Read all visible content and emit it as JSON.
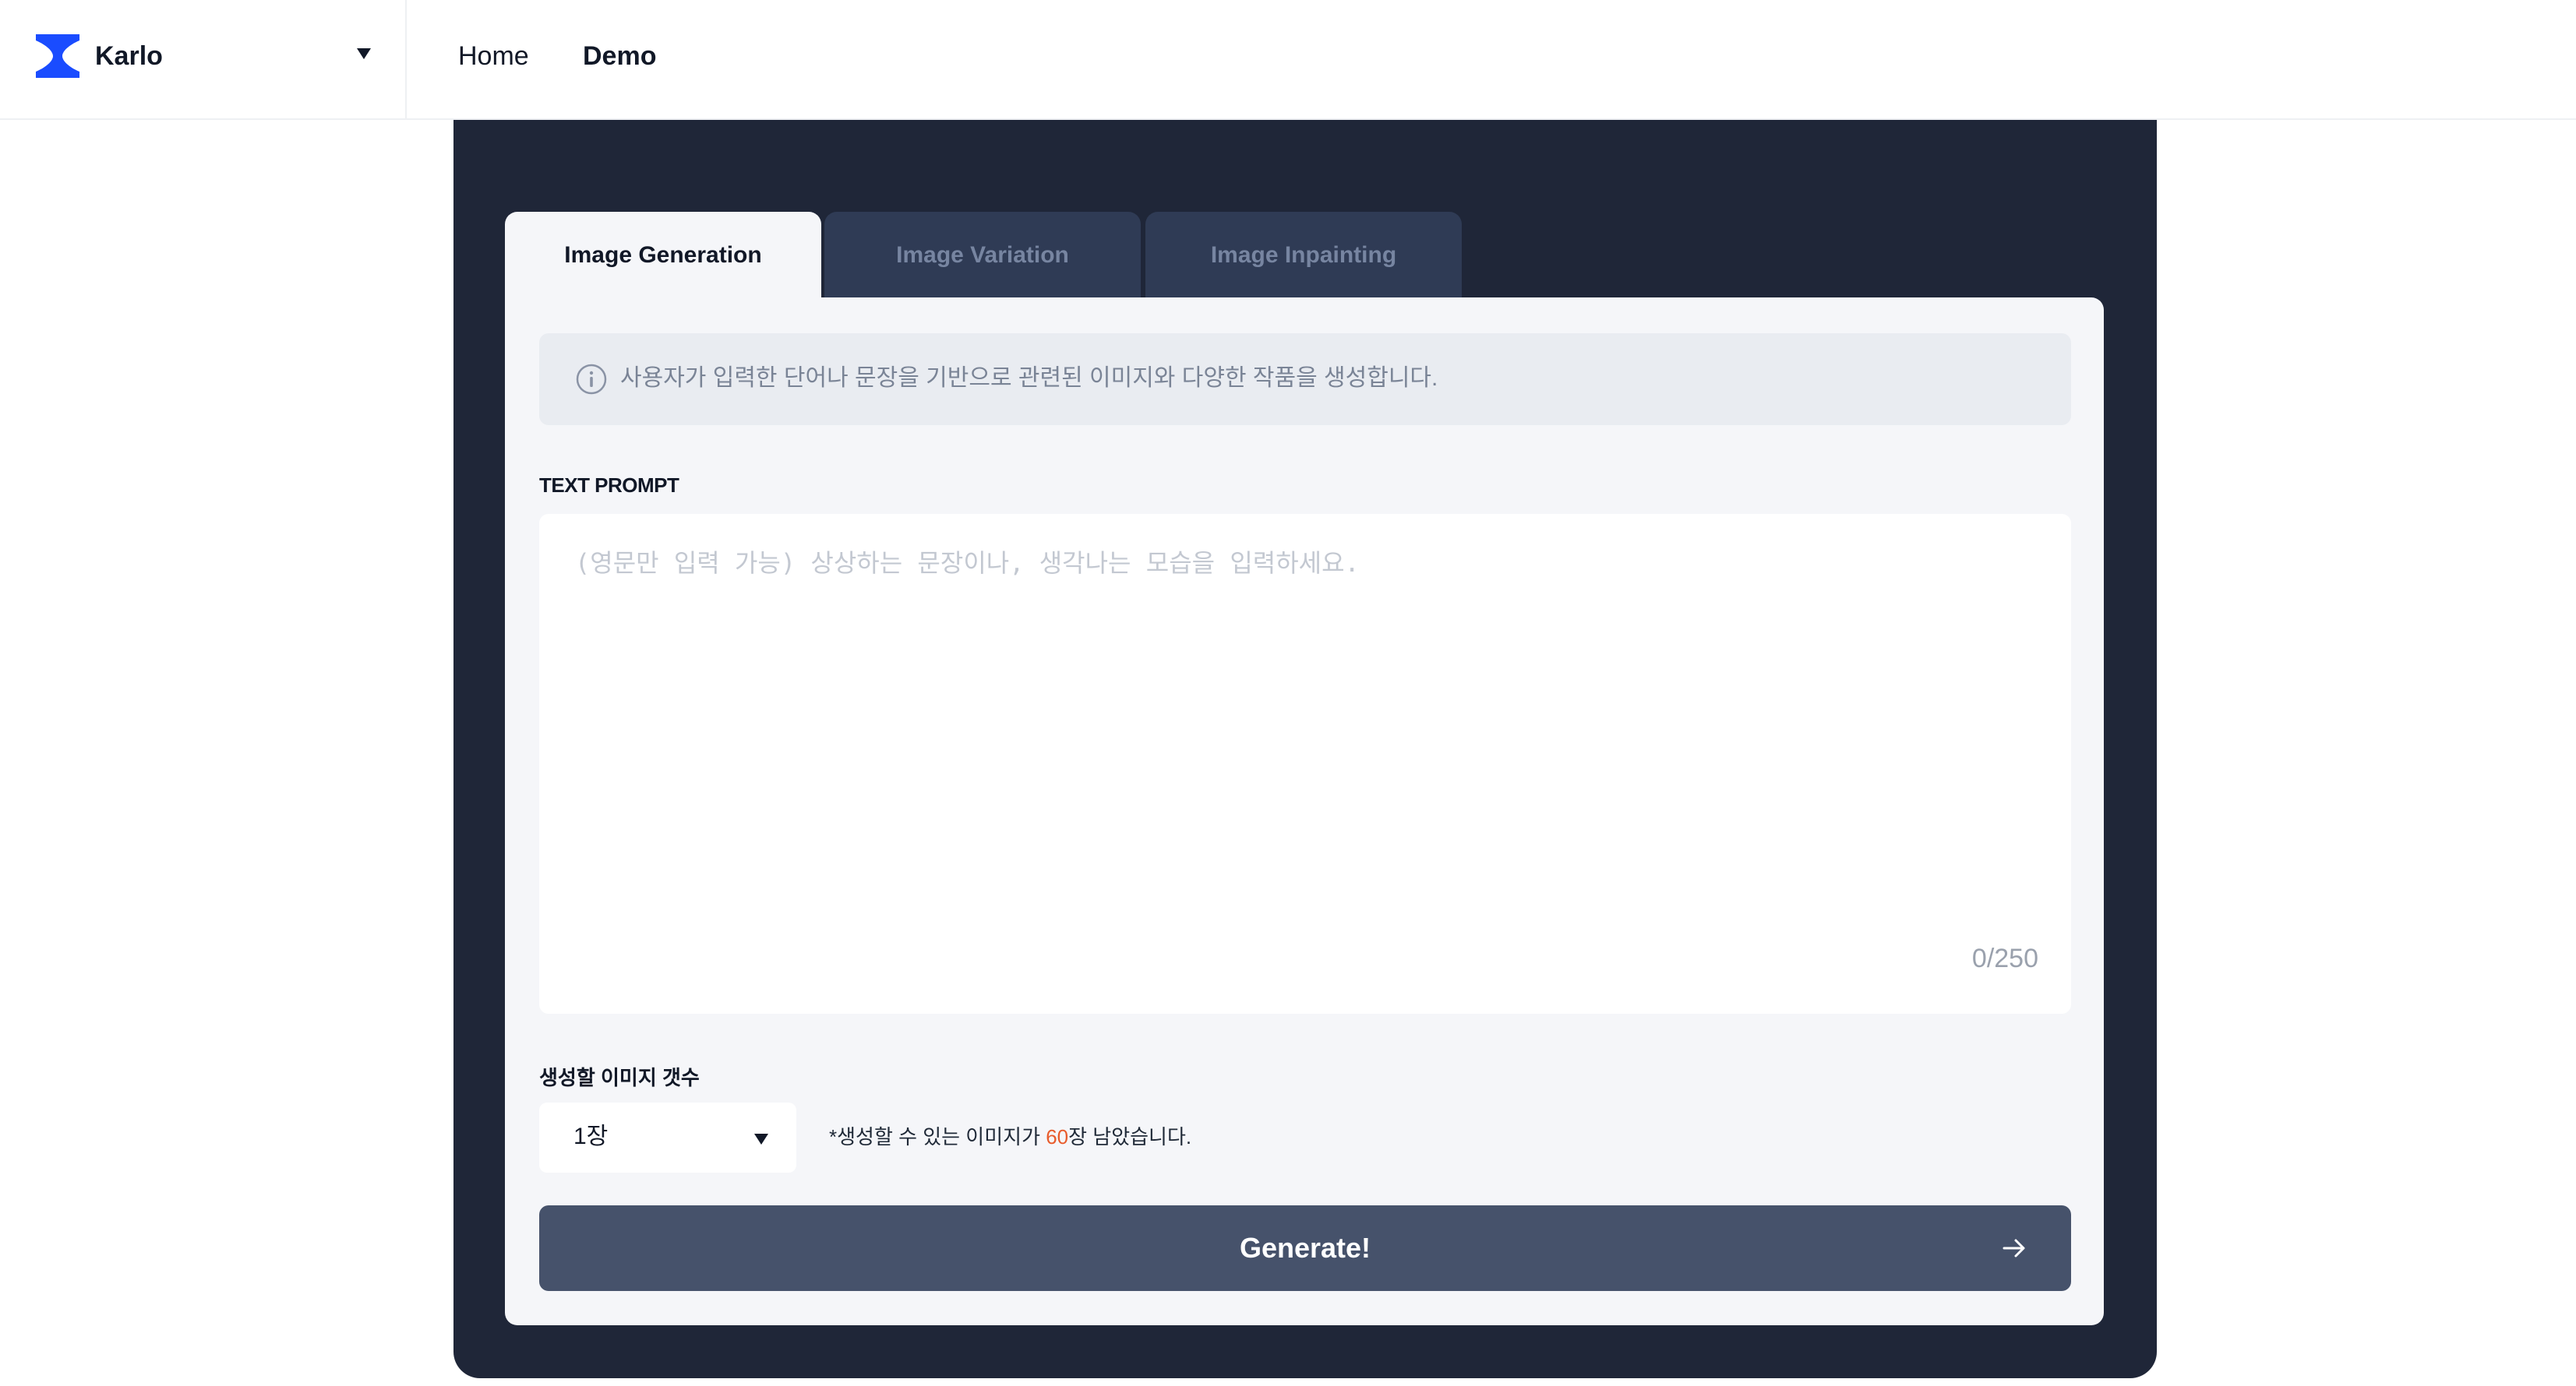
{
  "header": {
    "brand": "Karlo",
    "nav": {
      "home": "Home",
      "demo": "Demo"
    }
  },
  "tabs": [
    {
      "label": "Image Generation",
      "active": true
    },
    {
      "label": "Image Variation",
      "active": false
    },
    {
      "label": "Image Inpainting",
      "active": false
    }
  ],
  "info": {
    "icon": "info-circle-icon",
    "text": "사용자가 입력한 단어나 문장을 기반으로 관련된 이미지와 다양한 작품을 생성합니다."
  },
  "prompt": {
    "label": "TEXT PROMPT",
    "placeholder": "(영문만 입력 가능) 상상하는 문장이나, 생각나는 모습을 입력하세요.",
    "value": "",
    "counter": "0/250"
  },
  "image_count": {
    "label": "생성할 이미지 갯수",
    "selected": "1장",
    "remaining_prefix": "*생성할 수 있는 이미지가 ",
    "remaining_number": "60",
    "remaining_suffix": "장 남았습니다."
  },
  "generate": {
    "label": "Generate!",
    "icon": "arrow-right-icon"
  },
  "colors": {
    "brand_blue": "#1a4cff",
    "panel": "#1f2638",
    "button": "#46526b",
    "highlight": "#e85c2c"
  }
}
